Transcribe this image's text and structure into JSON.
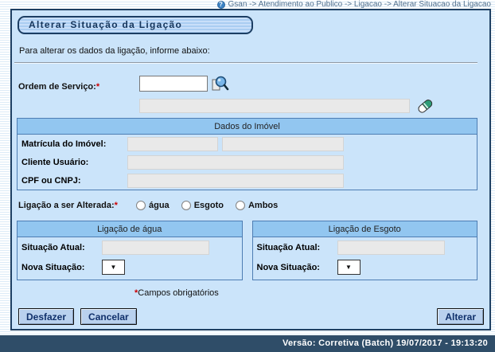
{
  "colors": {
    "content_bg": "#cbe4fa",
    "section_header_bg": "#92c6f0",
    "section_border": "#4d7db3",
    "window_border": "#1f4063",
    "footer_bg": "#2f4d68",
    "title_text": "#16365c",
    "required_mark": "#cc0000",
    "disabled_field_bg": "#e9e9e9"
  },
  "icons": {
    "help_glyph": "?",
    "dropdown_arrow": "▼"
  },
  "breadcrumb": {
    "path": "Gsan -> Atendimento ao Publico -> Ligacao -> Alterar Situacao da Ligacao"
  },
  "page": {
    "title": "Alterar Situação da Ligação",
    "intro": "Para alterar os dados da ligação, informe abaixo:"
  },
  "form": {
    "ordem_servico": {
      "label": "Ordem de Serviço:",
      "required_mark": "*",
      "value": "",
      "description_value": ""
    },
    "dados_imovel": {
      "title": "Dados do Imóvel",
      "rows": [
        {
          "label": "Matrícula do Imóvel:",
          "value1": "",
          "value2": ""
        },
        {
          "label": "Cliente Usuário:",
          "value": ""
        },
        {
          "label": "CPF ou CNPJ:",
          "value": ""
        }
      ]
    },
    "ligacao_a_ser_alterada": {
      "label": "Ligação a ser Alterada:",
      "required_mark": "*",
      "options": [
        {
          "label": "água",
          "selected": false
        },
        {
          "label": "Esgoto",
          "selected": false
        },
        {
          "label": "Ambos",
          "selected": false
        }
      ]
    },
    "panels": [
      {
        "title": "Ligação de água",
        "situacao_atual": {
          "label": "Situação Atual:",
          "value": ""
        },
        "nova_situacao": {
          "label": "Nova Situação:",
          "value": ""
        }
      },
      {
        "title": "Ligação de Esgoto",
        "situacao_atual": {
          "label": "Situação Atual:",
          "value": ""
        },
        "nova_situacao": {
          "label": "Nova Situação:",
          "value": ""
        }
      }
    ],
    "required_note": {
      "mark": "*",
      "text": "Campos obrigatórios"
    }
  },
  "buttons": {
    "desfazer": "Desfazer",
    "cancelar": "Cancelar",
    "alterar": "Alterar"
  },
  "footer": {
    "version_text": "Versão: Corretiva (Batch) 19/07/2017 - 19:13:20"
  }
}
